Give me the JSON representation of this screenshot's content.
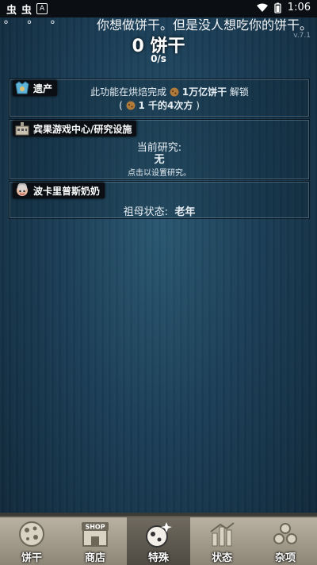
{
  "status_bar": {
    "left_icons": [
      "虫",
      "虫"
    ],
    "app_badge": "A",
    "time": "1:06"
  },
  "header": {
    "dots": "° ° °",
    "ticker": "你想做饼干。但是没人想吃你的饼干。",
    "version": "v.7.1",
    "cookie_count": "0 饼干",
    "per_second": "0/s"
  },
  "panels": {
    "legacy": {
      "title": "遗产",
      "line1_prefix": "此功能在烘焙完成",
      "line1_amount": "1万亿饼干",
      "line1_suffix": "解锁",
      "line2_open": "(",
      "line2_text": "1 千的4次方",
      "line2_close": ")"
    },
    "research": {
      "title": "宾果游戏中心/研究设施",
      "label": "当前研究:",
      "value": "无",
      "hint": "点击以设置研究。"
    },
    "grandma": {
      "title": "波卡里普斯奶奶",
      "label": "祖母状态:",
      "value": "老年"
    }
  },
  "bottom_nav": {
    "tabs": [
      {
        "label": "饼干",
        "icon": "cookie-icon"
      },
      {
        "label": "商店",
        "icon": "shop-icon"
      },
      {
        "label": "特殊",
        "icon": "special-icon"
      },
      {
        "label": "状态",
        "icon": "stats-icon"
      },
      {
        "label": "杂项",
        "icon": "misc-icon"
      }
    ],
    "shop_sign": "SHOP",
    "active_index": 2
  },
  "colors": {
    "background": "#1a3d55",
    "nav_bar": "#a59f90",
    "title_box": "#0b0f14"
  }
}
